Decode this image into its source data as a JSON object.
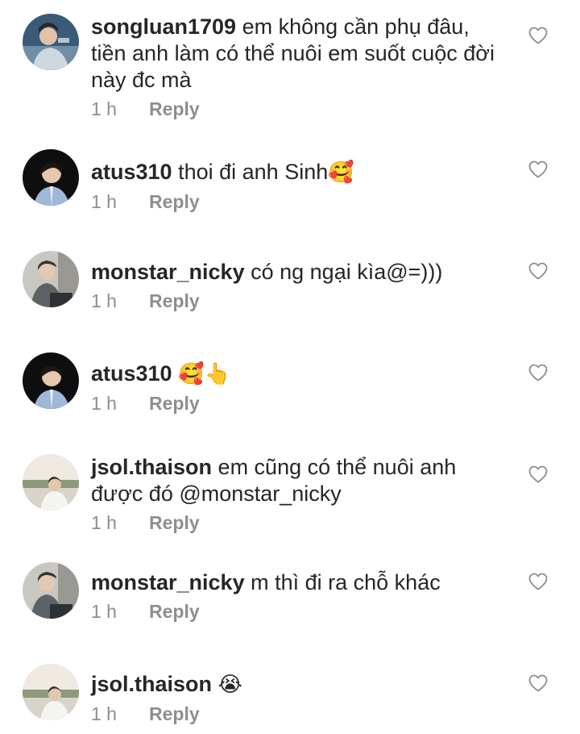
{
  "reply_label": "Reply",
  "heart_icon": "heart-outline-icon",
  "comments": [
    {
      "username": "songluan1709",
      "text": "em không cần phụ đâu, tiền anh làm có thể nuôi em suốt cuộc đời này đc mà",
      "emoji": "",
      "time": "1 h",
      "avatar": "avatar-songluan1709"
    },
    {
      "username": "atus310",
      "text": "thoi đi anh Sinh",
      "emoji": "🥰",
      "time": "1 h",
      "avatar": "avatar-atus310"
    },
    {
      "username": "monstar_nicky",
      "text": "có ng ngại kìa@=)))",
      "emoji": "",
      "time": "1 h",
      "avatar": "avatar-monstar_nicky"
    },
    {
      "username": "atus310",
      "text": "",
      "emoji": "🥰👆",
      "time": "1 h",
      "avatar": "avatar-atus310"
    },
    {
      "username": "jsol.thaison",
      "text": "em cũng có thể nuôi anh được đó @monstar_nicky",
      "emoji": "",
      "time": "1 h",
      "avatar": "avatar-jsol.thaison"
    },
    {
      "username": "monstar_nicky",
      "text": "m thì đi ra chỗ khác",
      "emoji": "",
      "time": "1 h",
      "avatar": "avatar-monstar_nicky"
    },
    {
      "username": "jsol.thaison",
      "text": "",
      "emoji": "😭",
      "time": "1 h",
      "avatar": "avatar-jsol.thaison"
    }
  ]
}
